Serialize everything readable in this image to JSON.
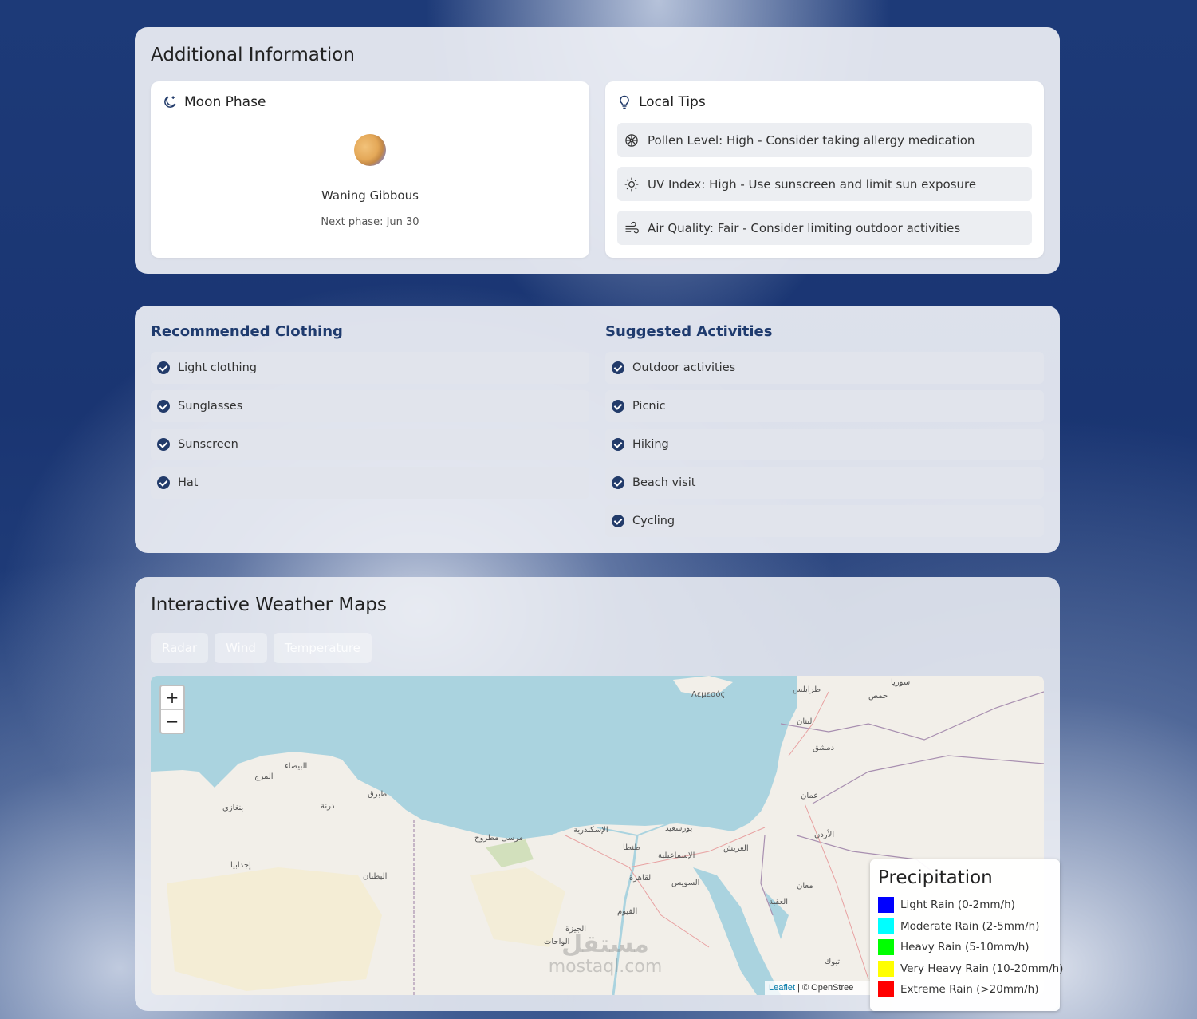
{
  "additional": {
    "title": "Additional Information",
    "moon": {
      "heading": "Moon Phase",
      "phase": "Waning Gibbous",
      "next": "Next phase: Jun 30"
    },
    "tips": {
      "heading": "Local Tips",
      "items": [
        {
          "icon": "pollen-icon",
          "text": "Pollen Level: High - Consider taking allergy medication"
        },
        {
          "icon": "sun-icon",
          "text": "UV Index: High - Use sunscreen and limit sun exposure"
        },
        {
          "icon": "wind-icon",
          "text": "Air Quality: Fair - Consider limiting outdoor activities"
        }
      ]
    }
  },
  "recommendations": {
    "clothing_title": "Recommended Clothing",
    "clothing": [
      "Light clothing",
      "Sunglasses",
      "Sunscreen",
      "Hat"
    ],
    "activities_title": "Suggested Activities",
    "activities": [
      "Outdoor activities",
      "Picnic",
      "Hiking",
      "Beach visit",
      "Cycling"
    ]
  },
  "maps": {
    "title": "Interactive Weather Maps",
    "tabs": [
      "Radar",
      "Wind",
      "Temperature"
    ],
    "zoom_in": "+",
    "zoom_out": "−",
    "attribution_link": "Leaflet",
    "attribution_text": "| © OpenStree",
    "watermark_ar": "مستقل",
    "watermark_en": "mostaql.com",
    "labels": [
      "Λεμεσός",
      "طرابلس",
      "لبنان",
      "دمشق",
      "عمان",
      "الإسكندرية",
      "القاهرة",
      "السويس",
      "الإسماعيلية",
      "بورسعيد",
      "طنطا",
      "البيضاء",
      "المرج",
      "بنغازي",
      "طبرق",
      "درنة",
      "مرسى مطروح",
      "إجدابيا",
      "البطنان",
      "الجيزة",
      "الفيوم",
      "العقبة",
      "تبوك",
      "الواحات",
      "سوريا",
      "الأردن",
      "حمص",
      "معان",
      "العريش"
    ]
  },
  "legend": {
    "title": "Precipitation",
    "items": [
      {
        "label": "Light Rain (0-2mm/h)",
        "color": "#0000ff"
      },
      {
        "label": "Moderate Rain (2-5mm/h)",
        "color": "#00ffff"
      },
      {
        "label": "Heavy Rain (5-10mm/h)",
        "color": "#00ff00"
      },
      {
        "label": "Very Heavy Rain (10-20mm/h)",
        "color": "#ffff00"
      },
      {
        "label": "Extreme Rain (>20mm/h)",
        "color": "#ff0000"
      }
    ]
  }
}
